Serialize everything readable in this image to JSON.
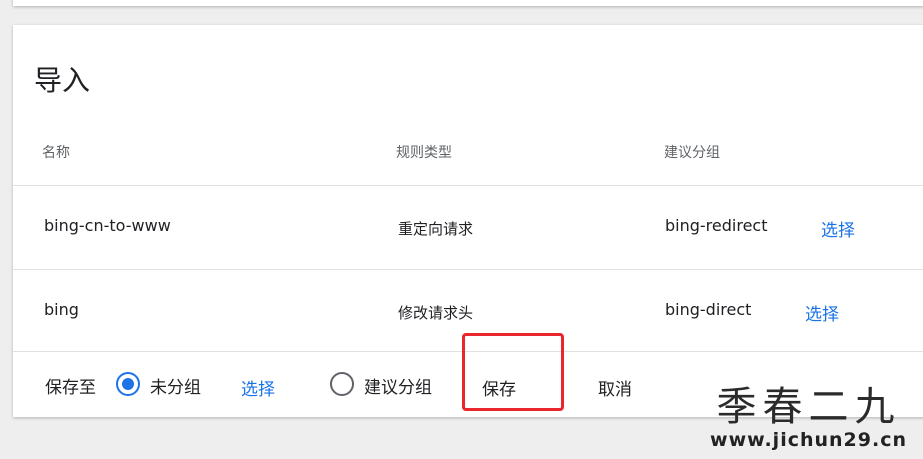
{
  "panel": {
    "title": "导入"
  },
  "table": {
    "headers": [
      "名称",
      "规则类型",
      "建议分组"
    ],
    "rows": [
      {
        "name": "bing-cn-to-www",
        "rule_type": "重定向请求",
        "group": "bing-redirect",
        "action": "选择"
      },
      {
        "name": "bing",
        "rule_type": "修改请求头",
        "group": "bing-direct",
        "action": "选择"
      }
    ]
  },
  "footer": {
    "save_to_label": "保存至",
    "option_ungrouped": "未分组",
    "choose_link": "选择",
    "option_suggested": "建议分组",
    "save_button": "保存",
    "cancel_button": "取消",
    "selected_option": "未分组"
  },
  "watermark": {
    "main": "季春二九",
    "url": "www.jichun29.cn"
  },
  "colors": {
    "accent": "#1a73e8",
    "highlight": "#e8262b"
  }
}
